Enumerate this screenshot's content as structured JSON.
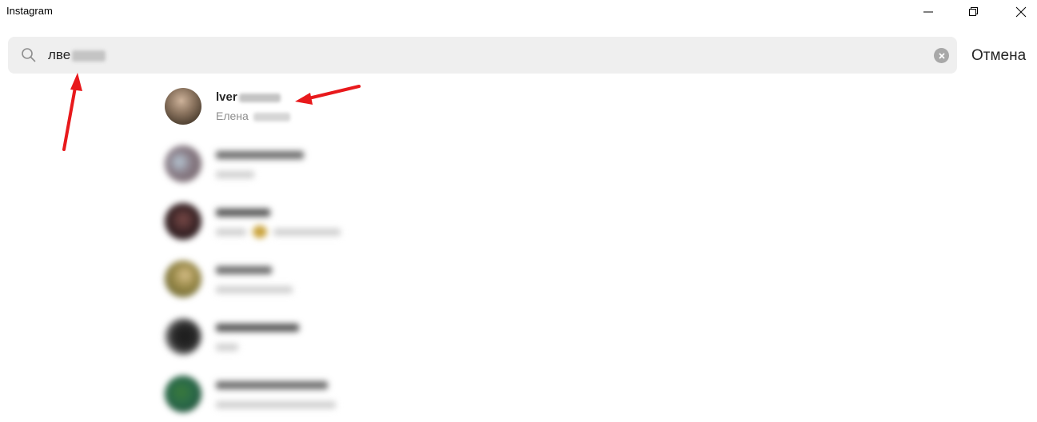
{
  "window": {
    "title": "Instagram",
    "controls": [
      "minimize-icon",
      "restore-icon",
      "close-icon"
    ]
  },
  "search": {
    "query": "лве",
    "clear_icon": "clear-icon",
    "search_icon": "search-icon",
    "cancel_label": "Отмена"
  },
  "results": [
    {
      "username": "lver",
      "fullname": "Елена",
      "blurred": false
    },
    {
      "username": "",
      "fullname": "",
      "blurred": true
    },
    {
      "username": "",
      "fullname": "",
      "blurred": true
    },
    {
      "username": "",
      "fullname": "",
      "blurred": true
    },
    {
      "username": "",
      "fullname": "",
      "blurred": true
    },
    {
      "username": "",
      "fullname": "",
      "blurred": true
    }
  ],
  "annotations": {
    "arrow_color": "#e8191c"
  }
}
